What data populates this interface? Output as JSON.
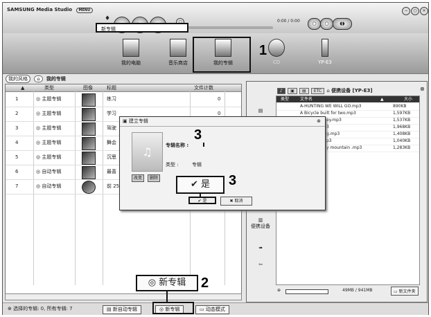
{
  "app": {
    "brand": "SAMSUNG Media Studio",
    "menu_label": "MENU",
    "time": "0:00 / 0:00"
  },
  "nav": {
    "items": [
      {
        "label": "我的电脑"
      },
      {
        "label": "音乐商店"
      },
      {
        "label": "我的专辑"
      },
      {
        "label": "CD"
      },
      {
        "label": "YP-E3"
      }
    ]
  },
  "breadcrumb": {
    "back": "我的风格",
    "current": "我的专辑"
  },
  "table": {
    "headers": {
      "type": "类型",
      "image": "图像",
      "title": "标题",
      "count": "文件计数"
    },
    "rows": [
      {
        "num": "1",
        "type": "主题专辑",
        "title": "练习",
        "count": "0"
      },
      {
        "num": "2",
        "type": "主题专辑",
        "title": "学习",
        "count": "0"
      },
      {
        "num": "3",
        "type": "主题专辑",
        "title": "驾驶",
        "count": ""
      },
      {
        "num": "4",
        "type": "主题专辑",
        "title": "舞会",
        "count": ""
      },
      {
        "num": "5",
        "type": "主题专辑",
        "title": "沉思",
        "count": ""
      },
      {
        "num": "6",
        "type": "自动专辑",
        "title": "最喜",
        "count": ""
      },
      {
        "num": "7",
        "type": "自动专辑",
        "title": "前 25",
        "count": ""
      }
    ]
  },
  "status": {
    "text": "选择的专辑: 0, 所有专辑: 7"
  },
  "bottom_buttons": {
    "new_auto": "新自动专辑",
    "new_album": "新专辑",
    "anim": "动态模式"
  },
  "device": {
    "title": "便携设备 [YP-E3]",
    "side_label": "便携设备",
    "headers": {
      "type": "类型",
      "name": "文件名",
      "size": "大小"
    },
    "files": [
      {
        "name": "A-HUNTING WE WILL GO.mp3",
        "size": "890KB"
      },
      {
        "name": "A Bicycle built for two.mp3",
        "size": "1,597KB"
      },
      {
        "name": "ey.mp3",
        "size": "1,537KB"
      },
      {
        "name": "3",
        "size": "1,968KB"
      },
      {
        "name": "g.mp3",
        "size": "1,408KB"
      },
      {
        "name": "p3",
        "size": "1,040KB"
      },
      {
        "name": "y mountain .mp3",
        "size": "1,283KB"
      }
    ],
    "storage": "49MB / 941MB",
    "new_folder": "新文件夹"
  },
  "dialog": {
    "title": "建立专辑",
    "name_label": "专辑名称 :",
    "name_value": "新专辑",
    "type_label": "类型 :",
    "type_value": "专辑",
    "change_btn": "改变",
    "delete_btn": "删除",
    "ok_big": "是",
    "ok_small": "是",
    "cancel": "取消"
  },
  "callouts": {
    "one": "1",
    "two": "2",
    "three_a": "3",
    "three_b": "3"
  },
  "zoomed": {
    "new_album": "新专辑"
  }
}
